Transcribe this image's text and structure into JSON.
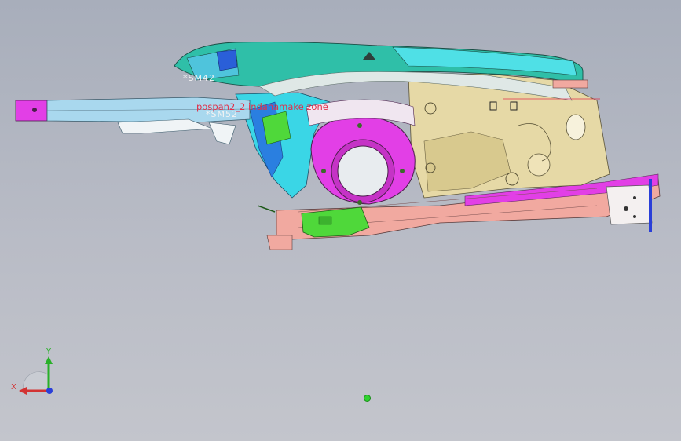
{
  "annotations": {
    "sm2": "*SM42",
    "sm3": "*SM52",
    "zone": "pospan2_2 indanamake zone"
  },
  "triad": {
    "x_label": "X",
    "y_label": "Y"
  },
  "colors": {
    "background": "#b9bcc6",
    "hood_teal": "#2fbfa8",
    "cyan_panel": "#3ad6e6",
    "beige_tower": "#e6d9a6",
    "magenta_strut": "#e23fe6",
    "salmon_rail": "#f1a9a0",
    "green_bracket": "#4fd83a",
    "light_blue_arm": "#a9d8ee",
    "axis_x": "#d23333",
    "axis_y": "#28b028",
    "axis_z": "#2a3fd8"
  },
  "icons": [
    "axis-triad-icon",
    "origin-marker-icon"
  ]
}
